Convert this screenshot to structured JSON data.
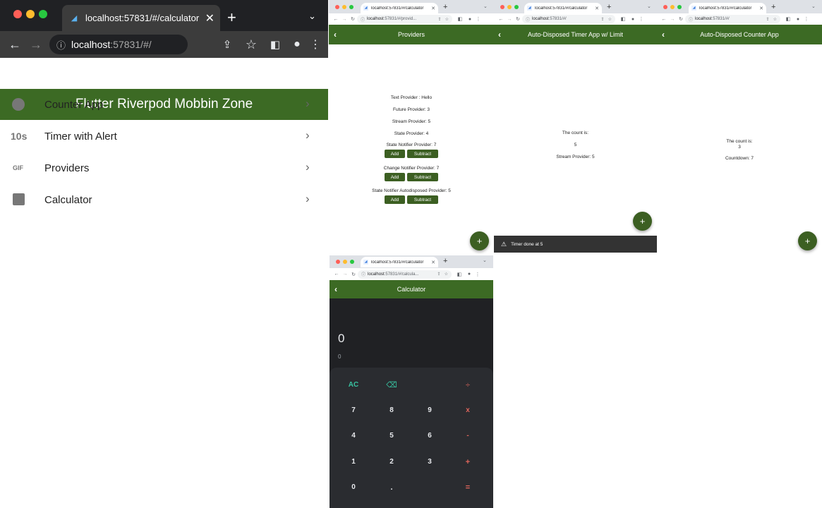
{
  "browser": {
    "tab_title": "localhost:57831/#/calculator",
    "favicon": "flutter-icon"
  },
  "main": {
    "url_host": "localhost",
    "url_path": ":57831/#/",
    "app_title": "Flutter Riverpod Mobbin Zone",
    "items": [
      {
        "label": "Counter App",
        "icon": "timer-icon"
      },
      {
        "label": "Timer with Alert",
        "icon": "timer-10s-icon",
        "icon_text": "10s"
      },
      {
        "label": "Providers",
        "icon": "gif-icon",
        "icon_text": "GIF"
      },
      {
        "label": "Calculator",
        "icon": "calculate-icon"
      }
    ]
  },
  "providers": {
    "url_host": "localhost",
    "url_path": ":57831/#/provid...",
    "title": "Providers",
    "text_provider": "Text Provider : Hello",
    "future_provider": "Future Provider: 3",
    "stream_provider": "Stream Provider: 5",
    "state_provider": "State Provider: 4",
    "state_notifier": "State Notifier Provider: 7",
    "change_notifier": "Change Notifier Provider: 7",
    "autodisposed": "State Notifier Autodisposed Provider: 5",
    "add_label": "Add",
    "subtract_label": "Subtract",
    "fab": "+"
  },
  "timer": {
    "url_host": "localhost",
    "url_path": ":57831/#/",
    "title": "Auto-Disposed Timer App w/ Limit",
    "count_label": "The count is:",
    "count_value": "5",
    "stream_provider": "Stream Provider: 5",
    "snackbar": "Timer done at 5",
    "fab": "+"
  },
  "counter": {
    "url_host": "localhost",
    "url_path": ":57831/#/",
    "title": "Auto-Disposed Counter App",
    "count_label": "The count is:",
    "count_value": "3",
    "countdown": "Countdown: 7",
    "fab": "+"
  },
  "calculator": {
    "url_host": "localhost",
    "url_path": ":57831/#/calcula...",
    "title": "Calculator",
    "display": "0",
    "result": "0",
    "keys": [
      [
        "AC",
        "⌫",
        "",
        "÷"
      ],
      [
        "7",
        "8",
        "9",
        "x"
      ],
      [
        "4",
        "5",
        "6",
        "-"
      ],
      [
        "1",
        "2",
        "3",
        "+"
      ],
      [
        "0",
        ".",
        "",
        "="
      ]
    ]
  },
  "colors": {
    "appbar": "#3c6a24",
    "button": "#3c5f22",
    "calc_bg": "#202124",
    "calc_keys": "#2a2c30",
    "calc_accent": "#e0665c",
    "calc_ac": "#38c2a0"
  }
}
